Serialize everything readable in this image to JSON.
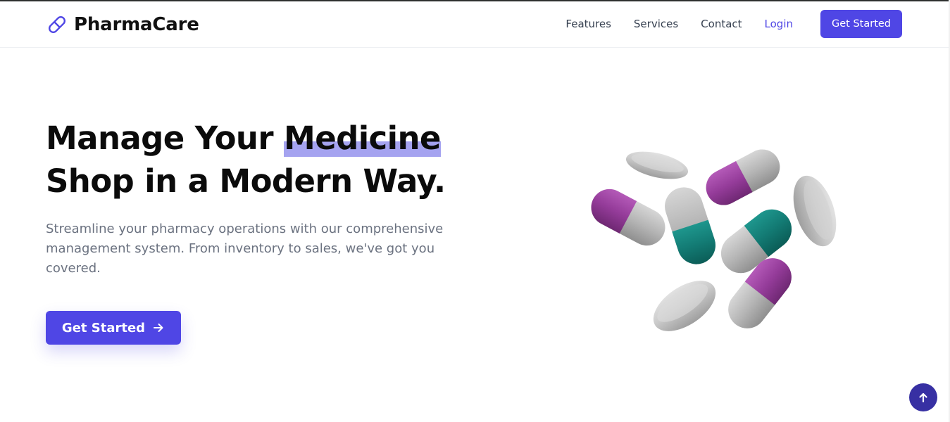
{
  "brand": {
    "name": "PharmaCare",
    "icon": "pill-icon",
    "accent_color": "#4f46e5"
  },
  "nav": {
    "items": [
      {
        "label": "Features"
      },
      {
        "label": "Services"
      },
      {
        "label": "Contact"
      }
    ],
    "login_label": "Login",
    "cta_label": "Get Started"
  },
  "hero": {
    "title_before": "Manage Your ",
    "title_highlight": "Medicine",
    "title_after": "Shop in a Modern Way.",
    "subtitle": "Streamline your pharmacy operations with our comprehensive management system. From inventory to sales, we've got you covered.",
    "cta_label": "Get Started",
    "cta_icon": "arrow-right-icon",
    "highlight_color": "#a5a3f0"
  },
  "illustration": {
    "name": "capsules-and-tablets",
    "capsule_colors": [
      "#9b3fa0",
      "#127a73"
    ],
    "shell_color": "#b9b9b9"
  },
  "scroll_top": {
    "icon": "arrow-up-icon",
    "color": "#3730a3"
  }
}
